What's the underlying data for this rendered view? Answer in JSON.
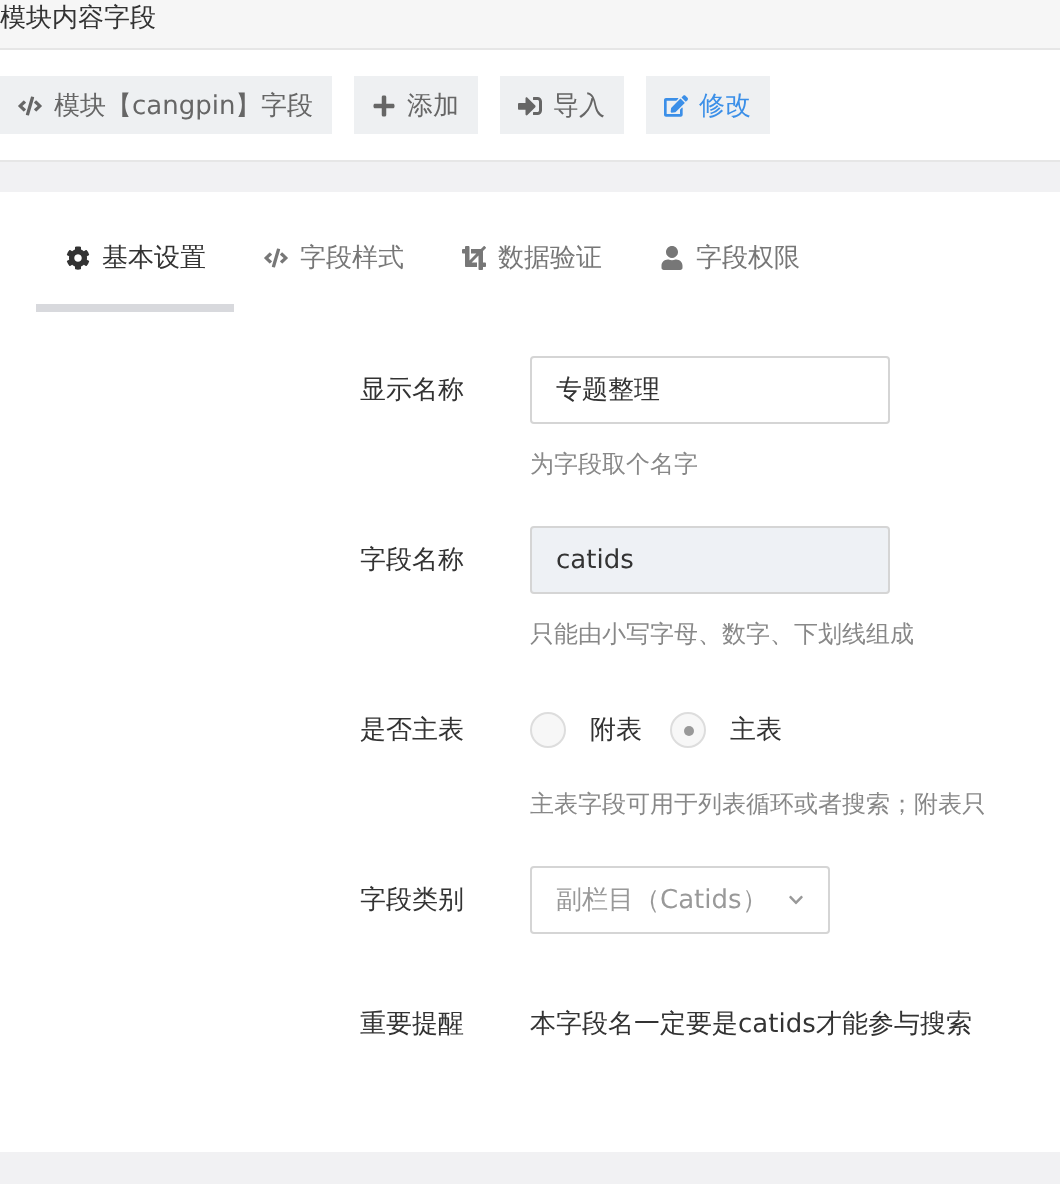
{
  "header": {
    "title": "模块内容字段"
  },
  "toolbar": [
    {
      "kind": "code",
      "label": "模块【cangpin】字段",
      "active": false
    },
    {
      "kind": "plus",
      "label": "添加",
      "active": false
    },
    {
      "kind": "import",
      "label": "导入",
      "active": false
    },
    {
      "kind": "edit",
      "label": "修改",
      "active": true
    }
  ],
  "tabs": [
    {
      "kind": "gear",
      "label": "基本设置",
      "selected": true
    },
    {
      "kind": "code",
      "label": "字段样式",
      "selected": false
    },
    {
      "kind": "crop",
      "label": "数据验证",
      "selected": false
    },
    {
      "kind": "user",
      "label": "字段权限",
      "selected": false
    }
  ],
  "form": [
    {
      "kind": "input",
      "label": "显示名称",
      "value": "专题整理",
      "disabled": false,
      "hint": "为字段取个名字"
    },
    {
      "kind": "input",
      "label": "字段名称",
      "value": "catids",
      "disabled": true,
      "hint": "只能由小写字母、数字、下划线组成"
    },
    {
      "kind": "radio",
      "label": "是否主表",
      "options": [
        {
          "label": "附表",
          "selected": false
        },
        {
          "label": "主表",
          "selected": true
        }
      ],
      "hint": "主表字段可用于列表循环或者搜索；附表只"
    },
    {
      "kind": "select",
      "label": "字段类别",
      "value": "副栏目（Catids）",
      "disabled": true
    },
    {
      "kind": "text",
      "label": "重要提醒",
      "value": "本字段名一定要是catids才能参与搜索"
    }
  ]
}
